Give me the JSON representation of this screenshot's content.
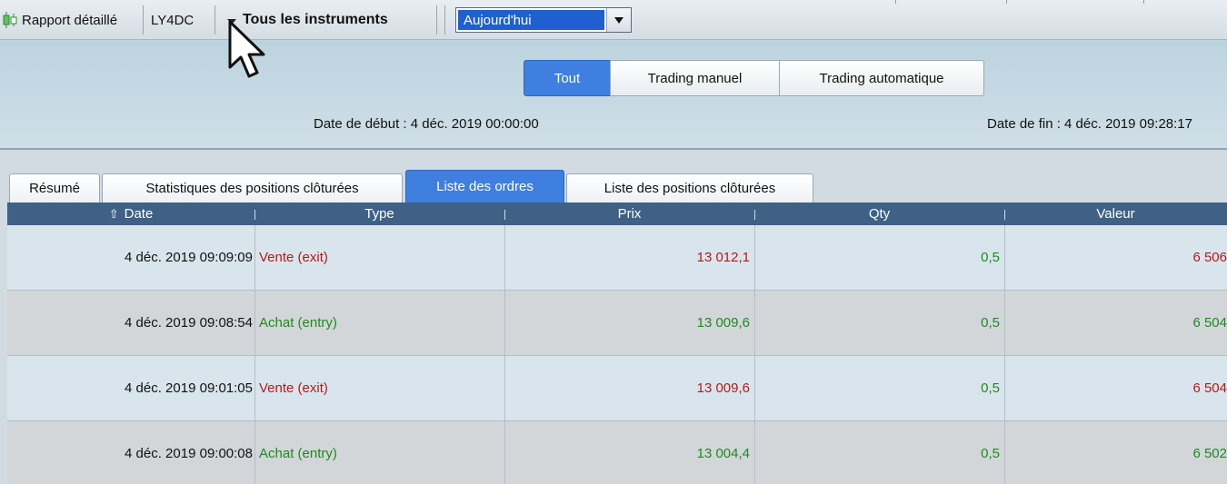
{
  "toolbar": {
    "report_label": "Rapport détaillé",
    "account": "LY4DC",
    "instruments_label": "Tous les instruments",
    "period_value": "Aujourd'hui"
  },
  "filter": {
    "segments": [
      "Tout",
      "Trading manuel",
      "Trading automatique"
    ],
    "active_segment": "Tout",
    "date_start": "Date de début : 4 déc. 2019 00:00:00",
    "date_end": "Date de fin : 4 déc. 2019 09:28:17"
  },
  "tabs": {
    "items": [
      "Résumé",
      "Statistiques des positions clôturées",
      "Liste des ordres",
      "Liste des positions clôturées"
    ],
    "active": "Liste des ordres"
  },
  "table": {
    "columns": [
      "Date",
      "Type",
      "Prix",
      "Qty",
      "Valeur"
    ],
    "rows": [
      {
        "date": "4 déc. 2019 09:09:09",
        "type": "Vente (exit)",
        "prix": "13 012,1",
        "qty": "0,5",
        "valeur": "6 506"
      },
      {
        "date": "4 déc. 2019 09:08:54",
        "type": "Achat (entry)",
        "prix": "13 009,6",
        "qty": "0,5",
        "valeur": "6 504"
      },
      {
        "date": "4 déc. 2019 09:01:05",
        "type": "Vente (exit)",
        "prix": "13 009,6",
        "qty": "0,5",
        "valeur": "6 504"
      },
      {
        "date": "4 déc. 2019 09:00:08",
        "type": "Achat (entry)",
        "prix": "13 004,4",
        "qty": "0,5",
        "valeur": "6 502"
      }
    ]
  },
  "colors": {
    "accent_blue": "#3f7fe0",
    "header_bg": "#3e6185",
    "sell_red": "#b51a1a",
    "buy_green": "#1f8a1f"
  },
  "icons": [
    "candlestick-icon",
    "dropdown-arrow-icon",
    "sort-up-icon",
    "mouse-cursor-icon"
  ]
}
